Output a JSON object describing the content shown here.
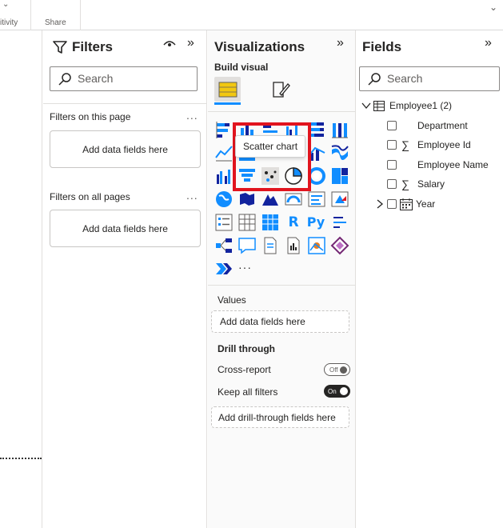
{
  "ribbon": {
    "items": [
      "itivity",
      "Share"
    ]
  },
  "filters": {
    "title": "Filters",
    "search_placeholder": "Search",
    "this_page_label": "Filters on this page",
    "this_page_well": "Add data fields here",
    "all_pages_label": "Filters on all pages",
    "all_pages_well": "Add data fields here",
    "ellipsis": "..."
  },
  "viz": {
    "title": "Visualizations",
    "build_visual_label": "Build visual",
    "tooltip": "Scatter chart",
    "more": "···",
    "values_label": "Values",
    "values_well": "Add data fields here",
    "drill_label": "Drill through",
    "cross_report_label": "Cross-report",
    "cross_report_state": "Off",
    "keep_filters_label": "Keep all filters",
    "keep_filters_state": "On",
    "drill_well": "Add drill-through fields here",
    "colors": {
      "highlight": "#e1141e",
      "accent": "#118dff",
      "yellow": "#f2c811"
    }
  },
  "fields": {
    "title": "Fields",
    "search_placeholder": "Search",
    "table_name": "Employee1 (2)",
    "items": [
      {
        "label": "Department",
        "kind": "text"
      },
      {
        "label": "Employee Id",
        "kind": "sum"
      },
      {
        "label": "Employee Name",
        "kind": "text"
      },
      {
        "label": "Salary",
        "kind": "sum"
      },
      {
        "label": "Year",
        "kind": "date"
      }
    ]
  }
}
